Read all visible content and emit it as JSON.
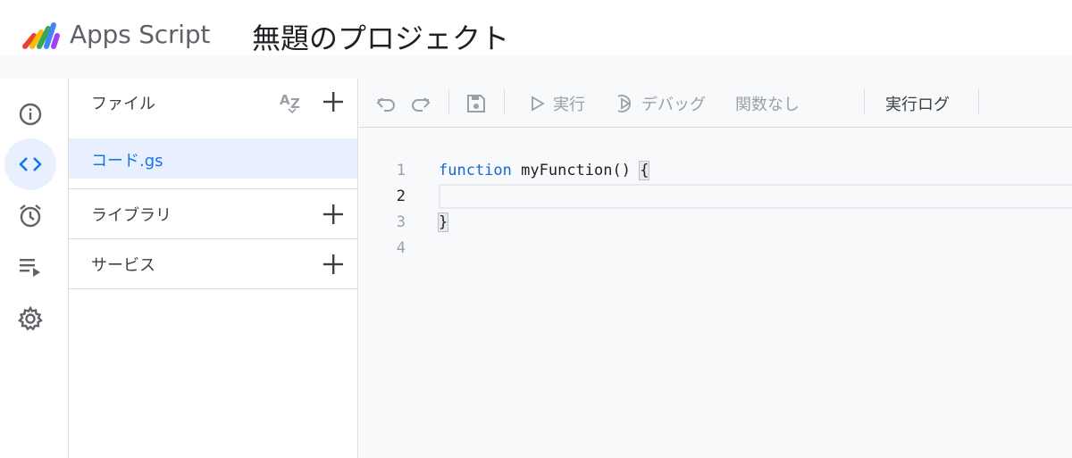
{
  "header": {
    "app_name": "Apps Script",
    "project_title": "無題のプロジェクト",
    "logo_colors": [
      "#ea4335",
      "#fbbc04",
      "#34a853",
      "#4285f4",
      "#a142f4"
    ]
  },
  "rail": {
    "items": [
      {
        "name": "overview",
        "icon": "info-icon"
      },
      {
        "name": "editor",
        "icon": "code-icon",
        "active": true
      },
      {
        "name": "triggers",
        "icon": "alarm-icon"
      },
      {
        "name": "executions",
        "icon": "executions-icon"
      },
      {
        "name": "settings",
        "icon": "gear-icon"
      }
    ]
  },
  "files": {
    "title": "ファイル",
    "sort_icon": "sort-az-icon",
    "add_icon": "plus-icon",
    "items": [
      {
        "name": "コード.gs",
        "selected": true
      }
    ],
    "libraries_label": "ライブラリ",
    "services_label": "サービス"
  },
  "toolbar": {
    "undo_icon": "undo-icon",
    "redo_icon": "redo-icon",
    "save_icon": "save-icon",
    "run_label": "実行",
    "debug_label": "デバッグ",
    "function_select": "関数なし",
    "log_label": "実行ログ"
  },
  "code": {
    "line_numbers": [
      "1",
      "2",
      "3",
      "4"
    ],
    "keyword": "function",
    "function_sig": "myFunction() ",
    "open_brace": "{",
    "close_brace": "}"
  },
  "colors": {
    "accent": "#1a73e8",
    "selected_bg": "#e8f0fe",
    "keyword": "#1967d2"
  }
}
